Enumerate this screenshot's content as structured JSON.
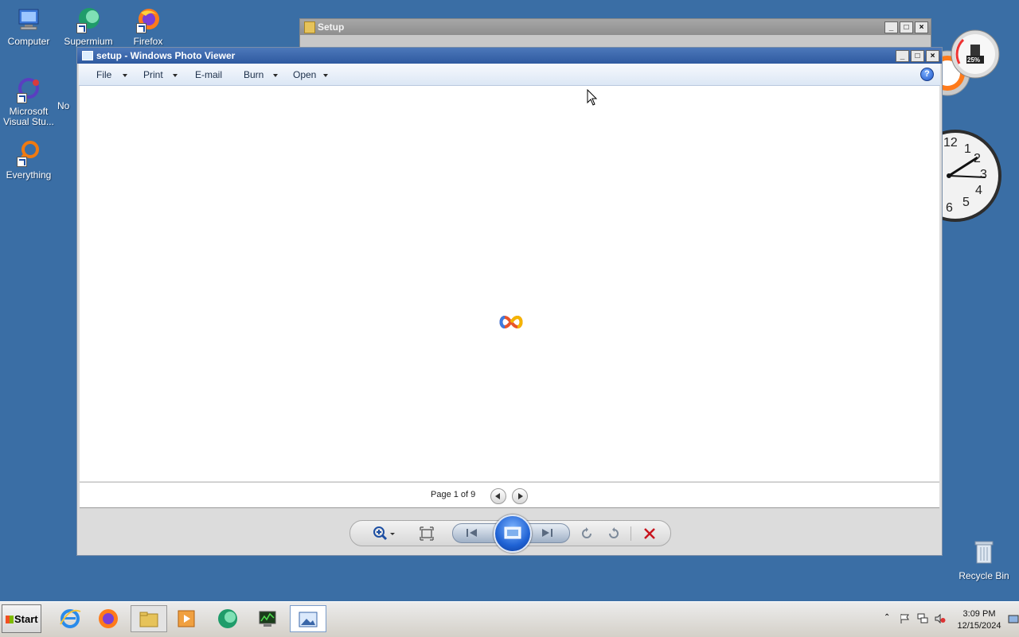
{
  "desktop": {
    "icons": [
      {
        "label": "Computer"
      },
      {
        "label": "Supermium"
      },
      {
        "label": "Firefox"
      },
      {
        "label": "Microsoft Visual Stu..."
      },
      {
        "label": "No"
      },
      {
        "label": "Everything"
      }
    ],
    "recycle_bin": "Recycle Bin"
  },
  "background_window": {
    "title": "Setup"
  },
  "gadgets": {
    "meter_percent": "25%",
    "clock_numbers": [
      "12",
      "1",
      "2",
      "3",
      "4",
      "5",
      "6"
    ]
  },
  "photo_viewer": {
    "title": "setup - Windows Photo Viewer",
    "menu": {
      "file": "File",
      "print": "Print",
      "email": "E-mail",
      "burn": "Burn",
      "open": "Open"
    },
    "help": "?",
    "page_info": "Page 1 of 9"
  },
  "taskbar": {
    "start": "Start",
    "time": "3:09 PM",
    "date": "12/15/2024"
  },
  "colors": {
    "desktop": "#3a6ea5",
    "titlebar": "#2f5aa0",
    "close_red": "#c8141e"
  }
}
